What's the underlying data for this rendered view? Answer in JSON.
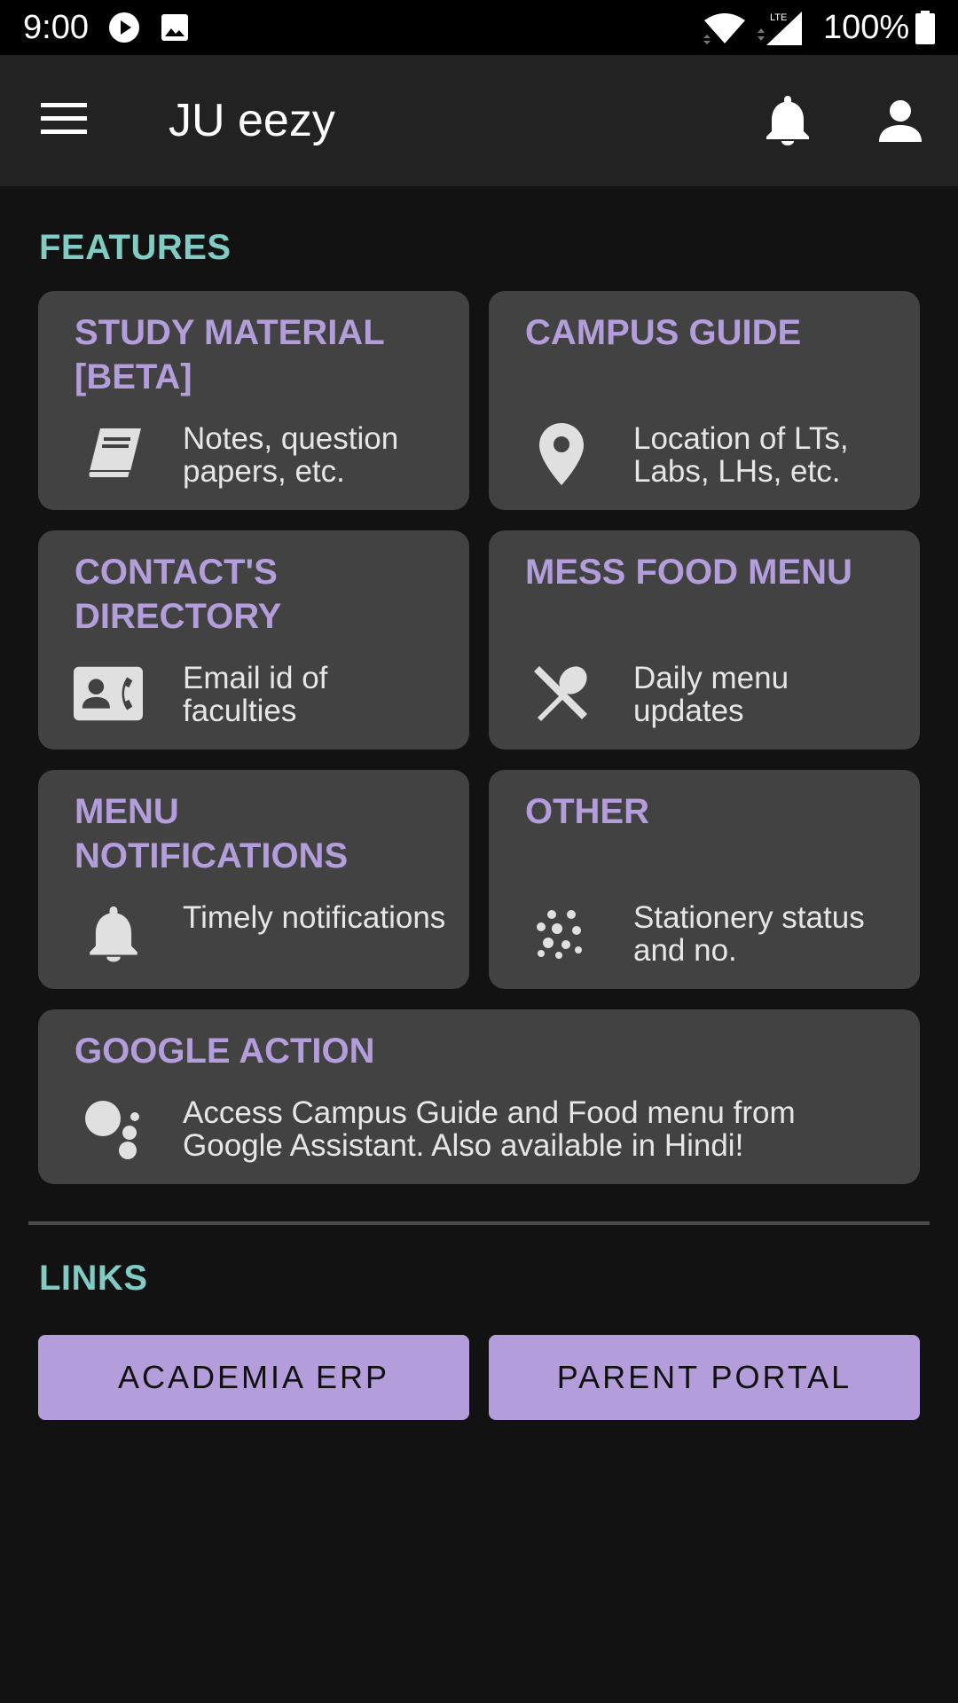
{
  "status_bar": {
    "time": "9:00",
    "network": "LTE",
    "battery": "100%",
    "icons": [
      "play-icon",
      "image-icon",
      "wifi-icon",
      "signal-icon",
      "battery-icon"
    ]
  },
  "app_bar": {
    "title": "JU eezy",
    "icons": [
      "menu-icon",
      "bell-icon",
      "account-icon"
    ]
  },
  "features": {
    "title": "FEATURES",
    "cards": [
      {
        "title": "STUDY MATERIAL [BETA]",
        "desc": "Notes, question papers, etc.",
        "icon": "book-icon"
      },
      {
        "title": "CAMPUS GUIDE",
        "desc": "Location of LTs, Labs, LHs, etc.",
        "icon": "location-pin-icon"
      },
      {
        "title": "CONTACT'S DIRECTORY",
        "desc": "Email id of faculties",
        "icon": "contact-card-icon"
      },
      {
        "title": "MESS FOOD MENU",
        "desc": "Daily menu updates",
        "icon": "utensils-icon"
      },
      {
        "title": "MENU NOTIFICATIONS",
        "desc": "Timely notifications",
        "icon": "bell-icon"
      },
      {
        "title": "OTHER",
        "desc": "Stationery status and no.",
        "icon": "dots-scatter-icon"
      },
      {
        "title": "GOOGLE ACTION",
        "desc": "Access Campus Guide and Food menu from Google Assistant. Also available in Hindi!",
        "icon": "google-assistant-icon"
      }
    ]
  },
  "links": {
    "title": "LINKS",
    "buttons": [
      "ACADEMIA ERP",
      "PARENT PORTAL"
    ]
  },
  "colors": {
    "background": "#121212",
    "app_bar": "#222222",
    "card": "#424242",
    "card_title": "#b39ddb",
    "section_title": "#80cbc4",
    "button": "#b39ddb"
  }
}
